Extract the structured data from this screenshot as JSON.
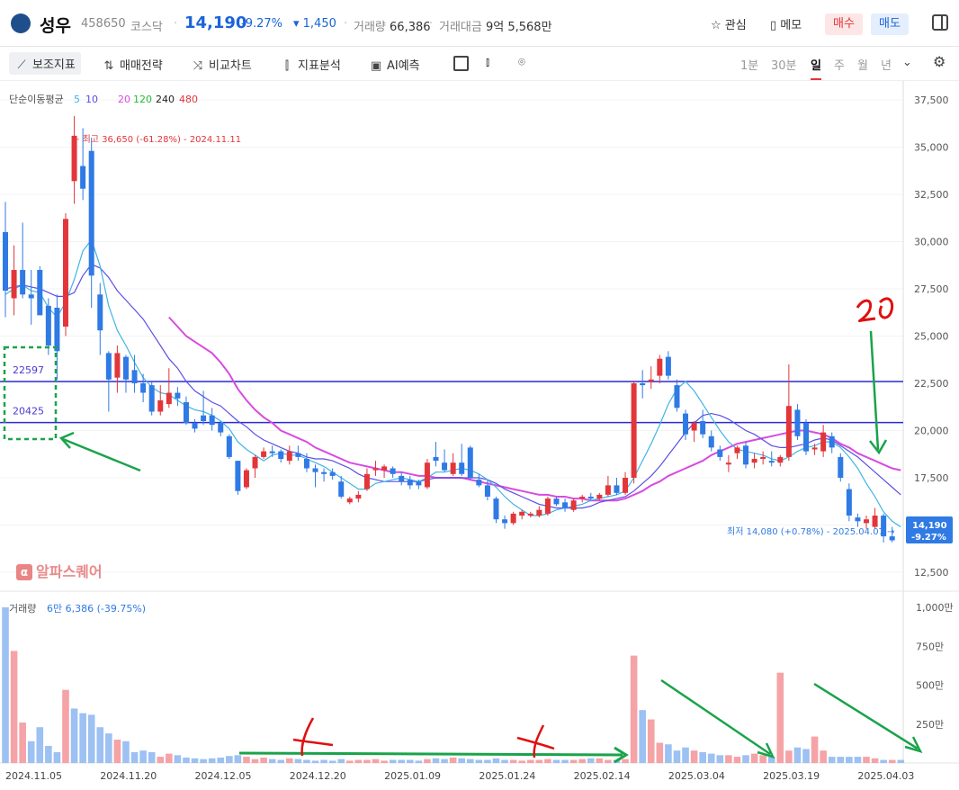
{
  "header": {
    "name": "성우",
    "code": "458650",
    "market": "코스닥",
    "price": "14,190",
    "change_pct": "-9.27%",
    "change_abs": "▾ 1,450",
    "volume_label": "거래량",
    "volume": "66,386",
    "amount_label": "거래대금",
    "amount": "9억 5,568만",
    "watch_label": "관심",
    "memo_label": "메모",
    "buy_label": "매수",
    "sell_label": "매도"
  },
  "toolbar": {
    "items": [
      "보조지표",
      "매매전략",
      "비교차트",
      "지표분석",
      "AI예측"
    ],
    "periods": [
      "1분",
      "30분",
      "일",
      "주",
      "월",
      "년"
    ],
    "active_period": "일"
  },
  "colors": {
    "up": "#e2363a",
    "down": "#2f7ae5",
    "vol_up": "#f5a3a6",
    "vol_down": "#9cc1f2",
    "ma5": "#3fb4e6",
    "ma10": "#5b4ee6",
    "ma20": "#d84be0",
    "ma120": "#22bb33",
    "ma240": "#222222",
    "ma480": "#e2363a",
    "hline": "#2a2ad6",
    "annot_green": "#1aa34a",
    "annot_red": "#e01010"
  },
  "ma_legend": {
    "label": "단순이동평균",
    "items": [
      {
        "value": "5",
        "color": "#3fb4e6"
      },
      {
        "value": "10",
        "color": "#5b4ee6"
      },
      {
        "value": "20",
        "color": "#d84be0"
      },
      {
        "value": "120",
        "color": "#22bb33"
      },
      {
        "value": "240",
        "color": "#222222"
      },
      {
        "value": "480",
        "color": "#e2363a"
      }
    ]
  },
  "watermark": "알파스퀘어",
  "chart_data": {
    "type": "candlestick",
    "y_ticks": [
      "37,500",
      "35,000",
      "32,500",
      "30,000",
      "27,500",
      "25,000",
      "22,500",
      "20,000",
      "17,500",
      "15,000",
      "12,500"
    ],
    "ylim": [
      11500,
      38500
    ],
    "x_tick_labels": [
      {
        "label": "2024.11.05",
        "index": 0
      },
      {
        "label": "2024.11.20",
        "index": 11
      },
      {
        "label": "2024.12.05",
        "index": 22
      },
      {
        "label": "2024.12.20",
        "index": 33
      },
      {
        "label": "2025.01.09",
        "index": 44
      },
      {
        "label": "2025.01.24",
        "index": 55
      },
      {
        "label": "2025.02.14",
        "index": 66
      },
      {
        "label": "2025.03.04",
        "index": 77
      },
      {
        "label": "2025.03.19",
        "index": 88
      },
      {
        "label": "2025.04.03",
        "index": 99
      }
    ],
    "max_label": "최고 36,650 (-61.28%) - 2024.11.11",
    "min_label": "최저 14,080 (+0.78%) - 2025.04.07",
    "last_price": "14,190",
    "last_change": "-9.27%",
    "hlines": [
      {
        "value": 22597,
        "label": "22597"
      },
      {
        "value": 20425,
        "label": "20425"
      }
    ],
    "candles": [
      {
        "o": 30500,
        "h": 32100,
        "l": 26000,
        "c": 27400
      },
      {
        "o": 27000,
        "h": 29800,
        "l": 26100,
        "c": 28500
      },
      {
        "o": 28500,
        "h": 31000,
        "l": 27000,
        "c": 27200
      },
      {
        "o": 27200,
        "h": 28500,
        "l": 25600,
        "c": 27000
      },
      {
        "o": 28500,
        "h": 28700,
        "l": 26500,
        "c": 26100
      },
      {
        "o": 26600,
        "h": 27000,
        "l": 24000,
        "c": 24500
      },
      {
        "o": 26500,
        "h": 27200,
        "l": 22700,
        "c": 24200
      },
      {
        "o": 25500,
        "h": 31500,
        "l": 25000,
        "c": 31200
      },
      {
        "o": 33200,
        "h": 36650,
        "l": 32000,
        "c": 35600
      },
      {
        "o": 34000,
        "h": 36000,
        "l": 32200,
        "c": 32800
      },
      {
        "o": 34800,
        "h": 35500,
        "l": 26500,
        "c": 28200
      },
      {
        "o": 27200,
        "h": 27800,
        "l": 24000,
        "c": 25300
      },
      {
        "o": 24100,
        "h": 24200,
        "l": 21000,
        "c": 22700
      },
      {
        "o": 22800,
        "h": 24500,
        "l": 22000,
        "c": 24100
      },
      {
        "o": 23900,
        "h": 24000,
        "l": 22000,
        "c": 22700
      },
      {
        "o": 23200,
        "h": 24000,
        "l": 22000,
        "c": 22500
      },
      {
        "o": 22500,
        "h": 23000,
        "l": 21500,
        "c": 22000
      },
      {
        "o": 22400,
        "h": 22600,
        "l": 20800,
        "c": 21000
      },
      {
        "o": 21000,
        "h": 22400,
        "l": 20800,
        "c": 21600
      },
      {
        "o": 21400,
        "h": 23300,
        "l": 21200,
        "c": 22000
      },
      {
        "o": 22000,
        "h": 22300,
        "l": 21300,
        "c": 21700
      },
      {
        "o": 21500,
        "h": 21800,
        "l": 20300,
        "c": 20400
      },
      {
        "o": 20400,
        "h": 20600,
        "l": 19900,
        "c": 20100
      },
      {
        "o": 20800,
        "h": 22100,
        "l": 20300,
        "c": 20500
      },
      {
        "o": 20800,
        "h": 21200,
        "l": 20000,
        "c": 20300
      },
      {
        "o": 20400,
        "h": 20500,
        "l": 19700,
        "c": 19900
      },
      {
        "o": 19700,
        "h": 19800,
        "l": 18500,
        "c": 18600
      },
      {
        "o": 18400,
        "h": 18400,
        "l": 16600,
        "c": 16800
      },
      {
        "o": 17000,
        "h": 18000,
        "l": 16900,
        "c": 17900
      },
      {
        "o": 18000,
        "h": 18700,
        "l": 17500,
        "c": 18600
      },
      {
        "o": 18600,
        "h": 19100,
        "l": 18500,
        "c": 18900
      },
      {
        "o": 18900,
        "h": 19200,
        "l": 18600,
        "c": 18800
      },
      {
        "o": 18900,
        "h": 19000,
        "l": 18300,
        "c": 18500
      },
      {
        "o": 18400,
        "h": 19200,
        "l": 18200,
        "c": 18900
      },
      {
        "o": 18800,
        "h": 19200,
        "l": 18400,
        "c": 18600
      },
      {
        "o": 18500,
        "h": 18800,
        "l": 17800,
        "c": 18000
      },
      {
        "o": 18000,
        "h": 18200,
        "l": 17000,
        "c": 17800
      },
      {
        "o": 17800,
        "h": 18000,
        "l": 17300,
        "c": 17700
      },
      {
        "o": 17800,
        "h": 18000,
        "l": 17400,
        "c": 17600
      },
      {
        "o": 17300,
        "h": 17600,
        "l": 16400,
        "c": 16500
      },
      {
        "o": 16200,
        "h": 16500,
        "l": 16100,
        "c": 16400
      },
      {
        "o": 16400,
        "h": 16800,
        "l": 16200,
        "c": 16600
      },
      {
        "o": 16900,
        "h": 18000,
        "l": 16800,
        "c": 17700
      },
      {
        "o": 17900,
        "h": 18400,
        "l": 17600,
        "c": 18000
      },
      {
        "o": 17900,
        "h": 18200,
        "l": 17500,
        "c": 18100
      },
      {
        "o": 18000,
        "h": 18100,
        "l": 17500,
        "c": 17700
      },
      {
        "o": 17600,
        "h": 17800,
        "l": 17100,
        "c": 17300
      },
      {
        "o": 17400,
        "h": 17600,
        "l": 16900,
        "c": 17100
      },
      {
        "o": 17300,
        "h": 17400,
        "l": 16900,
        "c": 17100
      },
      {
        "o": 17000,
        "h": 18500,
        "l": 16900,
        "c": 18300
      },
      {
        "o": 18600,
        "h": 19400,
        "l": 18100,
        "c": 18400
      },
      {
        "o": 18300,
        "h": 19000,
        "l": 17800,
        "c": 17900
      },
      {
        "o": 17700,
        "h": 18800,
        "l": 17600,
        "c": 18300
      },
      {
        "o": 18300,
        "h": 19300,
        "l": 17600,
        "c": 17700
      },
      {
        "o": 19100,
        "h": 19200,
        "l": 17400,
        "c": 17500
      },
      {
        "o": 17400,
        "h": 17700,
        "l": 17000,
        "c": 17100
      },
      {
        "o": 17100,
        "h": 17400,
        "l": 16300,
        "c": 16500
      },
      {
        "o": 16400,
        "h": 16500,
        "l": 15100,
        "c": 15300
      },
      {
        "o": 15300,
        "h": 15500,
        "l": 14800,
        "c": 15100
      },
      {
        "o": 15100,
        "h": 15700,
        "l": 15000,
        "c": 15600
      },
      {
        "o": 15500,
        "h": 15800,
        "l": 15300,
        "c": 15700
      },
      {
        "o": 15500,
        "h": 15700,
        "l": 15400,
        "c": 15600
      },
      {
        "o": 15500,
        "h": 16000,
        "l": 15400,
        "c": 15800
      },
      {
        "o": 15600,
        "h": 16500,
        "l": 15500,
        "c": 16400
      },
      {
        "o": 16400,
        "h": 16500,
        "l": 16000,
        "c": 16100
      },
      {
        "o": 16200,
        "h": 16400,
        "l": 15700,
        "c": 15900
      },
      {
        "o": 15800,
        "h": 16400,
        "l": 15700,
        "c": 16300
      },
      {
        "o": 16400,
        "h": 16600,
        "l": 16200,
        "c": 16500
      },
      {
        "o": 16500,
        "h": 16700,
        "l": 16300,
        "c": 16400
      },
      {
        "o": 16400,
        "h": 16700,
        "l": 16300,
        "c": 16600
      },
      {
        "o": 16600,
        "h": 17600,
        "l": 16500,
        "c": 17100
      },
      {
        "o": 17100,
        "h": 17500,
        "l": 16600,
        "c": 16700
      },
      {
        "o": 16700,
        "h": 17800,
        "l": 16600,
        "c": 17500
      },
      {
        "o": 17500,
        "h": 22600,
        "l": 17200,
        "c": 22500
      },
      {
        "o": 22500,
        "h": 23200,
        "l": 21700,
        "c": 22400
      },
      {
        "o": 22600,
        "h": 23400,
        "l": 22200,
        "c": 22700
      },
      {
        "o": 22900,
        "h": 24000,
        "l": 22500,
        "c": 23800
      },
      {
        "o": 23900,
        "h": 24200,
        "l": 22700,
        "c": 22900
      },
      {
        "o": 22400,
        "h": 22700,
        "l": 21000,
        "c": 21200
      },
      {
        "o": 20900,
        "h": 21100,
        "l": 19500,
        "c": 19800
      },
      {
        "o": 20000,
        "h": 20500,
        "l": 19400,
        "c": 20400
      },
      {
        "o": 20500,
        "h": 21100,
        "l": 19600,
        "c": 19800
      },
      {
        "o": 19700,
        "h": 20000,
        "l": 18900,
        "c": 19100
      },
      {
        "o": 19000,
        "h": 19200,
        "l": 18400,
        "c": 18600
      },
      {
        "o": 18200,
        "h": 18700,
        "l": 17800,
        "c": 18300
      },
      {
        "o": 18800,
        "h": 19200,
        "l": 18500,
        "c": 19100
      },
      {
        "o": 19200,
        "h": 19400,
        "l": 18000,
        "c": 18200
      },
      {
        "o": 18300,
        "h": 18800,
        "l": 18000,
        "c": 18500
      },
      {
        "o": 18500,
        "h": 18900,
        "l": 18200,
        "c": 18600
      },
      {
        "o": 18400,
        "h": 18900,
        "l": 18100,
        "c": 18300
      },
      {
        "o": 18300,
        "h": 18700,
        "l": 18100,
        "c": 18600
      },
      {
        "o": 18600,
        "h": 23500,
        "l": 18400,
        "c": 21300
      },
      {
        "o": 21100,
        "h": 21400,
        "l": 19500,
        "c": 19700
      },
      {
        "o": 20400,
        "h": 20600,
        "l": 18700,
        "c": 18900
      },
      {
        "o": 19000,
        "h": 19300,
        "l": 18700,
        "c": 19100
      },
      {
        "o": 18900,
        "h": 20300,
        "l": 18600,
        "c": 19900
      },
      {
        "o": 19700,
        "h": 19900,
        "l": 18800,
        "c": 19100
      },
      {
        "o": 18600,
        "h": 18800,
        "l": 17300,
        "c": 17500
      },
      {
        "o": 16900,
        "h": 17200,
        "l": 15200,
        "c": 15500
      },
      {
        "o": 15400,
        "h": 15600,
        "l": 14900,
        "c": 15200
      },
      {
        "o": 15100,
        "h": 15500,
        "l": 14800,
        "c": 15300
      },
      {
        "o": 14900,
        "h": 15900,
        "l": 14800,
        "c": 15500
      },
      {
        "o": 15500,
        "h": 15600,
        "l": 14080,
        "c": 14400
      },
      {
        "o": 14400,
        "h": 14900,
        "l": 14080,
        "c": 14190
      }
    ],
    "ma5": [
      27200,
      27500,
      27700,
      27400,
      27300,
      26500,
      26000,
      26800,
      28000,
      29500,
      30100,
      28700,
      26600,
      25300,
      24500,
      23600,
      22800,
      22300,
      22000,
      21900,
      21600,
      21300,
      21100,
      21000,
      20800,
      20500,
      20100,
      19400,
      19000,
      18700,
      18400,
      18700,
      18800,
      18700,
      18700,
      18500,
      18300,
      18100,
      17800,
      17500,
      17200,
      16900,
      16900,
      17200,
      17300,
      17400,
      17500,
      17400,
      17300,
      17500,
      17800,
      17800,
      17900,
      18000,
      17900,
      17700,
      17400,
      17000,
      16500,
      16100,
      15800,
      15500,
      15500,
      15600,
      15800,
      15900,
      16000,
      16100,
      16300,
      16400,
      16500,
      16600,
      16800,
      17500,
      18400,
      19300,
      20300,
      21400,
      22200,
      22600,
      22100,
      21400,
      20700,
      20000,
      19400,
      19000,
      18900,
      18800,
      18700,
      18500,
      18400,
      18600,
      18900,
      19100,
      19200,
      19400,
      19400,
      19100,
      18600,
      18000,
      17200,
      16500,
      15700,
      15200,
      14900
    ],
    "ma10": [
      27500,
      27600,
      27700,
      27600,
      27500,
      27300,
      27100,
      27100,
      27300,
      28200,
      28800,
      28600,
      28100,
      27400,
      26900,
      26400,
      25900,
      25200,
      24500,
      23800,
      23300,
      22600,
      22100,
      21800,
      21500,
      21300,
      20900,
      20500,
      20200,
      19800,
      19500,
      19300,
      19100,
      18900,
      18800,
      18600,
      18500,
      18500,
      18400,
      18200,
      18000,
      17700,
      17500,
      17400,
      17300,
      17300,
      17300,
      17300,
      17300,
      17400,
      17500,
      17500,
      17500,
      17500,
      17500,
      17500,
      17400,
      17200,
      16900,
      16700,
      16500,
      16300,
      16100,
      16000,
      15900,
      15900,
      15900,
      15900,
      16000,
      16200,
      16300,
      16400,
      16500,
      16800,
      17200,
      17600,
      18100,
      18700,
      19300,
      19900,
      20400,
      20800,
      20900,
      20800,
      20600,
      20300,
      20000,
      19800,
      19500,
      19200,
      19100,
      19100,
      19200,
      19300,
      19500,
      19600,
      19500,
      19200,
      18900,
      18600,
      18200,
      17800,
      17400,
      17000,
      16600
    ],
    "ma20": [
      null,
      null,
      null,
      null,
      null,
      null,
      null,
      null,
      null,
      null,
      null,
      null,
      null,
      null,
      null,
      null,
      null,
      null,
      null,
      26000,
      25500,
      25000,
      24700,
      24400,
      24100,
      23600,
      23000,
      22200,
      21600,
      21100,
      20700,
      20400,
      20000,
      19800,
      19600,
      19400,
      19100,
      18900,
      18700,
      18500,
      18300,
      18200,
      18100,
      18000,
      17900,
      17800,
      17800,
      17700,
      17600,
      17600,
      17500,
      17500,
      17500,
      17500,
      17400,
      17300,
      17200,
      17100,
      17000,
      16900,
      16800,
      16700,
      16600,
      16600,
      16500,
      16500,
      16400,
      16400,
      16300,
      16300,
      16300,
      16300,
      16400,
      16600,
      16800,
      17100,
      17300,
      17600,
      17800,
      18000,
      18200,
      18400,
      18700,
      18900,
      19100,
      19300,
      19400,
      19500,
      19600,
      19700,
      19800,
      19900,
      20000,
      20000,
      19900,
      19800,
      19600,
      19300,
      19100,
      18800,
      18600,
      18400,
      18200,
      18000,
      17900
    ]
  },
  "volume": {
    "label": "거래량",
    "summary": "6만 6,386 (-39.75%)",
    "y_ticks": [
      "1,000만",
      "750만",
      "500만",
      "250만"
    ],
    "max": 1000,
    "bars": [
      1000,
      720,
      260,
      140,
      230,
      110,
      70,
      470,
      350,
      320,
      310,
      230,
      190,
      150,
      140,
      70,
      80,
      70,
      40,
      60,
      50,
      35,
      30,
      25,
      30,
      35,
      45,
      50,
      40,
      25,
      35,
      25,
      20,
      30,
      25,
      20,
      15,
      20,
      15,
      25,
      15,
      20,
      20,
      25,
      15,
      20,
      20,
      20,
      15,
      25,
      30,
      25,
      35,
      30,
      25,
      20,
      20,
      30,
      20,
      20,
      15,
      20,
      20,
      25,
      20,
      20,
      20,
      25,
      30,
      30,
      20,
      20,
      25,
      690,
      340,
      280,
      130,
      120,
      80,
      100,
      80,
      70,
      60,
      50,
      50,
      40,
      50,
      60,
      50,
      40,
      580,
      80,
      100,
      90,
      170,
      80,
      40,
      40,
      40,
      40,
      40,
      30,
      20,
      20,
      20
    ],
    "up": [
      false,
      true,
      true,
      false,
      false,
      false,
      false,
      true,
      false,
      false,
      false,
      false,
      false,
      true,
      false,
      false,
      false,
      false,
      true,
      true,
      false,
      false,
      false,
      false,
      false,
      false,
      false,
      false,
      true,
      true,
      true,
      false,
      false,
      true,
      false,
      false,
      false,
      false,
      false,
      false,
      true,
      true,
      true,
      true,
      true,
      false,
      false,
      false,
      false,
      true,
      false,
      false,
      true,
      false,
      false,
      false,
      false,
      false,
      false,
      true,
      true,
      true,
      true,
      true,
      false,
      false,
      true,
      true,
      false,
      true,
      true,
      false,
      true,
      true,
      false,
      true,
      true,
      false,
      false,
      false,
      true,
      false,
      false,
      false,
      true,
      true,
      false,
      true,
      true,
      false,
      true,
      true,
      false,
      false,
      true,
      true,
      false,
      false,
      false,
      false,
      true,
      true,
      false,
      true,
      false
    ]
  },
  "annotations": {
    "handwritten_number": "20"
  }
}
